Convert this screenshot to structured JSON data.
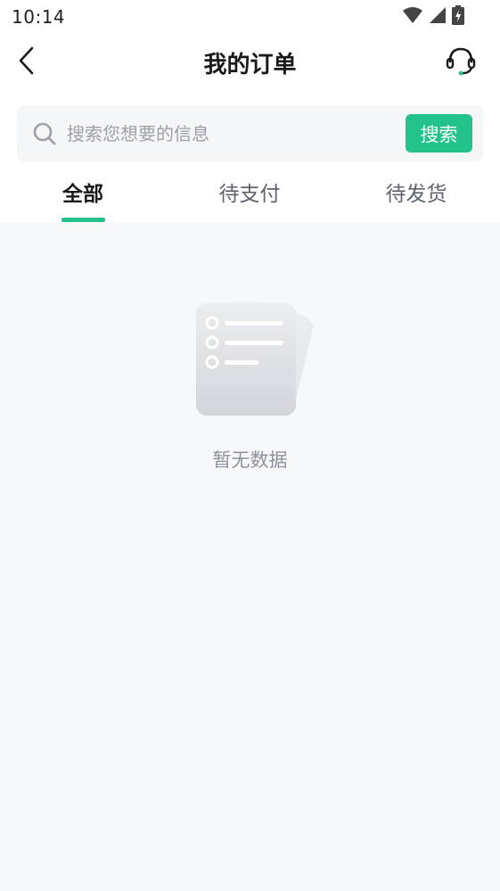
{
  "status_bar": {
    "time": "10:14",
    "icons": [
      "wifi-icon",
      "signal-icon",
      "battery-charging-icon"
    ]
  },
  "header": {
    "title": "我的订单",
    "back_icon": "chevron-left-icon",
    "service_icon": "headset-icon"
  },
  "search": {
    "placeholder": "搜索您想要的信息",
    "value": "",
    "button_label": "搜索"
  },
  "tabs": [
    {
      "label": "全部",
      "active": true
    },
    {
      "label": "待支付",
      "active": false
    },
    {
      "label": "待发货",
      "active": false
    }
  ],
  "empty_state": {
    "message": "暂无数据",
    "icon": "empty-document-icon"
  },
  "colors": {
    "accent": "#22c28a",
    "background": "#f7f8fa",
    "title": "#1a1a1a",
    "muted": "#8d939c"
  }
}
